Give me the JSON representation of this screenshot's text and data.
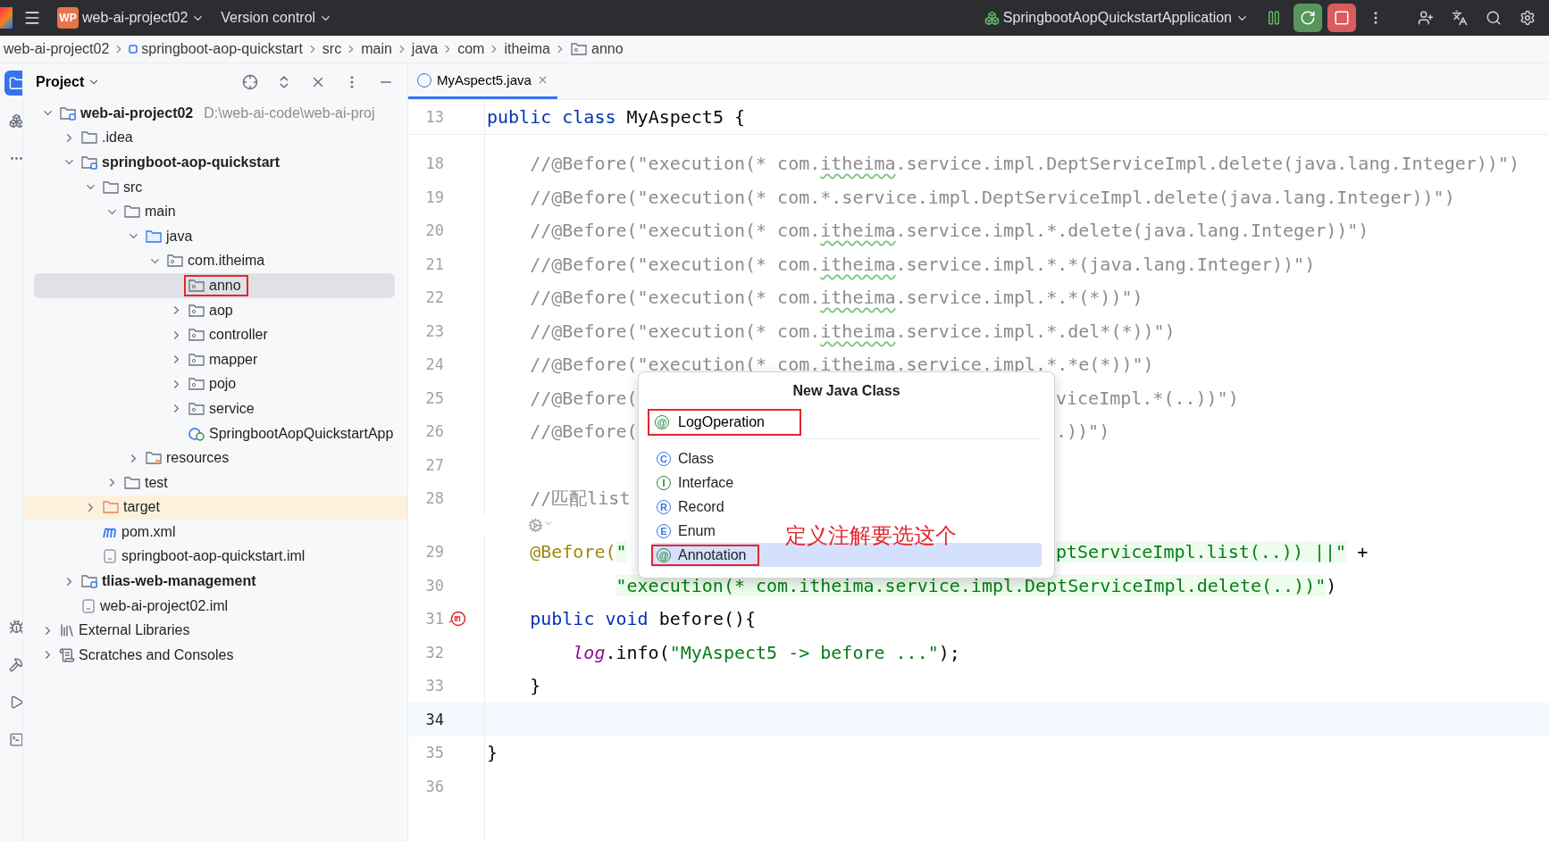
{
  "title_bar": {
    "project_badge": "WP",
    "project": "web-ai-project02",
    "vcs": "Version control",
    "run_config": "SpringbootAopQuickstartApplication"
  },
  "breadcrumbs": [
    {
      "kind": "module",
      "label": "web-ai-project02"
    },
    {
      "kind": "module_icon",
      "label": "springboot-aop-quickstart"
    },
    {
      "kind": "plain",
      "label": "src"
    },
    {
      "kind": "plain",
      "label": "main"
    },
    {
      "kind": "plain",
      "label": "java"
    },
    {
      "kind": "plain",
      "label": "com"
    },
    {
      "kind": "plain",
      "label": "itheima"
    },
    {
      "kind": "package",
      "label": "anno"
    }
  ],
  "project_panel": {
    "title": "Project",
    "tree": [
      {
        "kind": "module",
        "label": "web-ai-project02",
        "path": "D:\\web-ai-code\\web-ai-proj",
        "expanded": true,
        "selected": false,
        "boxed": false,
        "children": [
          {
            "kind": "folder",
            "label": ".idea",
            "expanded": false,
            "selected": false,
            "boxed": false
          },
          {
            "kind": "module",
            "label": "springboot-aop-quickstart",
            "expanded": true,
            "selected": false,
            "boxed": false,
            "children": [
              {
                "kind": "folder",
                "label": "src",
                "expanded": true,
                "selected": false,
                "boxed": false,
                "children": [
                  {
                    "kind": "folder",
                    "label": "main",
                    "expanded": true,
                    "selected": false,
                    "boxed": false,
                    "children": [
                      {
                        "kind": "source",
                        "label": "java",
                        "expanded": true,
                        "selected": false,
                        "boxed": false,
                        "children": [
                          {
                            "kind": "package",
                            "label": "com.itheima",
                            "expanded": true,
                            "selected": false,
                            "boxed": false,
                            "children": [
                              {
                                "kind": "package",
                                "label": "anno",
                                "selected": true,
                                "boxed": true
                              },
                              {
                                "kind": "package",
                                "label": "aop",
                                "expanded": false,
                                "selected": false,
                                "boxed": false
                              },
                              {
                                "kind": "package",
                                "label": "controller",
                                "expanded": false,
                                "selected": false,
                                "boxed": false
                              },
                              {
                                "kind": "package",
                                "label": "mapper",
                                "expanded": false,
                                "selected": false,
                                "boxed": false
                              },
                              {
                                "kind": "package",
                                "label": "pojo",
                                "expanded": false,
                                "selected": false,
                                "boxed": false
                              },
                              {
                                "kind": "package",
                                "label": "service",
                                "expanded": false,
                                "selected": false,
                                "boxed": false
                              },
                              {
                                "kind": "app",
                                "label": "SpringbootAopQuickstartApp",
                                "selected": false,
                                "boxed": false
                              }
                            ]
                          }
                        ]
                      },
                      {
                        "kind": "resources",
                        "label": "resources",
                        "expanded": false,
                        "selected": false,
                        "boxed": false
                      }
                    ]
                  },
                  {
                    "kind": "folder",
                    "label": "test",
                    "expanded": false,
                    "selected": false,
                    "boxed": false
                  }
                ]
              },
              {
                "kind": "excluded",
                "label": "target",
                "expanded": false,
                "selected": false,
                "boxed": false
              },
              {
                "kind": "maven",
                "label": "pom.xml",
                "selected": false,
                "boxed": false
              },
              {
                "kind": "file",
                "label": "springboot-aop-quickstart.iml",
                "selected": false,
                "boxed": false
              }
            ]
          },
          {
            "kind": "module",
            "label": "tlias-web-management",
            "expanded": false,
            "selected": false,
            "boxed": false
          },
          {
            "kind": "file",
            "label": "web-ai-project02.iml",
            "selected": false,
            "boxed": false
          }
        ]
      },
      {
        "kind": "libraries",
        "label": "External Libraries",
        "expanded": false,
        "selected": false,
        "boxed": false
      },
      {
        "kind": "scratches",
        "label": "Scratches and Consoles",
        "expanded": false,
        "selected": false,
        "boxed": false
      }
    ]
  },
  "editor": {
    "tabs": [
      {
        "label": "MyAspect5.java",
        "selected": true
      }
    ],
    "sticky_line": {
      "number": "13",
      "segments": [
        {
          "kind": "keyword",
          "text": "public class"
        },
        {
          "kind": "plain",
          "text": " MyAspect5 {"
        }
      ]
    },
    "lines": [
      {
        "kind": "code",
        "number": "18",
        "current": false,
        "segments": [
          {
            "kind": "comment",
            "text": "    //@Before(\"execution(* com."
          },
          {
            "kind": "typo",
            "text": "itheima"
          },
          {
            "kind": "comment",
            "text": ".service.impl.DeptServiceImpl.delete(java.lang.Integer))\")"
          }
        ]
      },
      {
        "kind": "code",
        "number": "19",
        "current": false,
        "segments": [
          {
            "kind": "comment",
            "text": "    //@Before(\"execution(* com.*.service.impl.DeptServiceImpl.delete(java.lang.Integer))\")"
          }
        ]
      },
      {
        "kind": "code",
        "number": "20",
        "current": false,
        "segments": [
          {
            "kind": "comment",
            "text": "    //@Before(\"execution(* com."
          },
          {
            "kind": "typo",
            "text": "itheima"
          },
          {
            "kind": "comment",
            "text": ".service.impl.*.delete(java.lang.Integer))\")"
          }
        ]
      },
      {
        "kind": "code",
        "number": "21",
        "current": false,
        "segments": [
          {
            "kind": "comment",
            "text": "    //@Before(\"execution(* com."
          },
          {
            "kind": "typo",
            "text": "itheima"
          },
          {
            "kind": "comment",
            "text": ".service.impl.*.*(java.lang.Integer))\")"
          }
        ]
      },
      {
        "kind": "code",
        "number": "22",
        "current": false,
        "segments": [
          {
            "kind": "comment",
            "text": "    //@Before(\"execution(* com."
          },
          {
            "kind": "typo",
            "text": "itheima"
          },
          {
            "kind": "comment",
            "text": ".service.impl.*.*(*))\")"
          }
        ]
      },
      {
        "kind": "code",
        "number": "23",
        "current": false,
        "segments": [
          {
            "kind": "comment",
            "text": "    //@Before(\"execution(* com."
          },
          {
            "kind": "typo",
            "text": "itheima"
          },
          {
            "kind": "comment",
            "text": ".service.impl.*.del*(*))\")"
          }
        ]
      },
      {
        "kind": "code",
        "number": "24",
        "current": false,
        "segments": [
          {
            "kind": "comment",
            "text": "    //@Before(\"execution(* com.itheima.service.impl.*.*e(*))\")"
          }
        ]
      },
      {
        "kind": "code",
        "number": "25",
        "current": false,
        "segments": [
          {
            "kind": "comment",
            "text": "    //@Before("
          }
        ],
        "tail": [
          {
            "kind": "comment",
            "text": "viceImpl.*(..))\")"
          }
        ]
      },
      {
        "kind": "code",
        "number": "26",
        "current": false,
        "segments": [
          {
            "kind": "comment",
            "text": "    //@Before("
          }
        ],
        "tail": [
          {
            "kind": "comment",
            "text": ".))\")"
          }
        ]
      },
      {
        "kind": "code",
        "number": "27",
        "current": false
      },
      {
        "kind": "code",
        "number": "28",
        "current": false,
        "segments": [
          {
            "kind": "comment",
            "text": "    //匹配list"
          }
        ]
      },
      {
        "kind": "inlay"
      },
      {
        "kind": "code",
        "number": "29",
        "current": false,
        "segments": [
          {
            "kind": "annotation",
            "text": "    @Before("
          },
          {
            "kind": "string_hl",
            "text": "\""
          }
        ],
        "tail": [
          {
            "kind": "string_hl",
            "text": "ptServiceImpl.list(..)) ||\""
          },
          {
            "kind": "plain",
            "text": " +"
          }
        ]
      },
      {
        "kind": "code",
        "number": "30",
        "current": false,
        "segments": [
          {
            "kind": "string_hl",
            "text": "            \"execution(* com.itheima.service.impl.DeptServiceImpl.delete(..))\""
          },
          {
            "kind": "plain",
            "text": ")"
          }
        ]
      },
      {
        "kind": "code",
        "number": "31",
        "current": false,
        "advice_marker": true,
        "segments": [
          {
            "kind": "keyword",
            "text": "    public void"
          },
          {
            "kind": "plain",
            "text": " before(){"
          }
        ]
      },
      {
        "kind": "code",
        "number": "32",
        "current": false,
        "segments": [
          {
            "kind": "field",
            "text": "        log"
          },
          {
            "kind": "plain",
            "text": ".info("
          },
          {
            "kind": "string",
            "text": "\"MyAspect5 -> before ...\""
          },
          {
            "kind": "plain",
            "text": ");"
          }
        ]
      },
      {
        "kind": "code",
        "number": "33",
        "current": false,
        "segments": [
          {
            "kind": "plain",
            "text": "    }"
          }
        ]
      },
      {
        "kind": "code",
        "number": "34",
        "current": true
      },
      {
        "kind": "code",
        "number": "35",
        "current": false,
        "segments": [
          {
            "kind": "plain",
            "text": "}"
          }
        ]
      },
      {
        "kind": "code",
        "number": "36",
        "current": false
      }
    ]
  },
  "new_class_popup": {
    "title": "New Java Class",
    "field": {
      "icon": "@",
      "value": "LogOperation",
      "boxed": true
    },
    "options": [
      {
        "icon": "C",
        "label": "Class",
        "color": "#3574f0",
        "selected": false,
        "boxed": false
      },
      {
        "icon": "I",
        "label": "Interface",
        "color": "#208a3c",
        "selected": false,
        "boxed": false
      },
      {
        "icon": "R",
        "label": "Record",
        "color": "#3574f0",
        "selected": false,
        "boxed": false
      },
      {
        "icon": "E",
        "label": "Enum",
        "color": "#3574f0",
        "selected": false,
        "boxed": false
      },
      {
        "icon": "@",
        "label": "Annotation",
        "color": "#208a3c",
        "selected": true,
        "boxed": true
      }
    ],
    "note": "定义注解要选这个"
  }
}
